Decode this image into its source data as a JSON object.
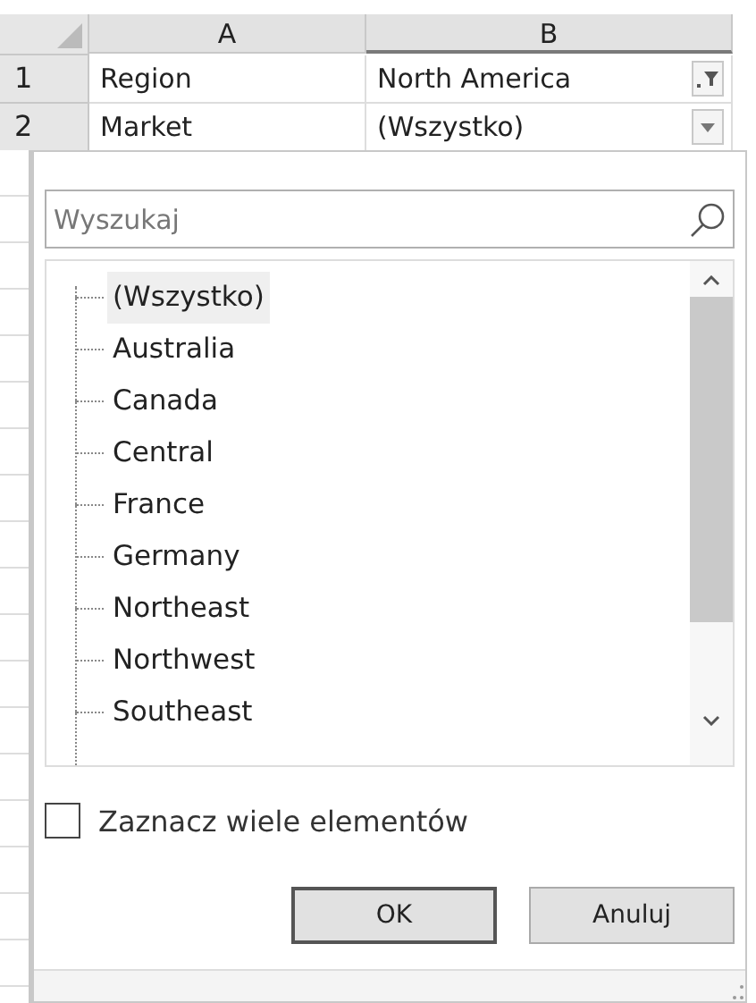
{
  "columns": [
    "A",
    "B"
  ],
  "rows": [
    {
      "number": "1",
      "label": "Region",
      "value": "North America",
      "kind": "filter"
    },
    {
      "number": "2",
      "label": "Market",
      "value": "(Wszystko)",
      "kind": "dropdown"
    }
  ],
  "filter_panel": {
    "search": {
      "placeholder": "Wyszukaj"
    },
    "items": [
      {
        "label": "(Wszystko)",
        "selected": true
      },
      {
        "label": "Australia",
        "selected": false
      },
      {
        "label": "Canada",
        "selected": false
      },
      {
        "label": "Central",
        "selected": false
      },
      {
        "label": "France",
        "selected": false
      },
      {
        "label": "Germany",
        "selected": false
      },
      {
        "label": "Northeast",
        "selected": false
      },
      {
        "label": "Northwest",
        "selected": false
      },
      {
        "label": "Southeast",
        "selected": false
      }
    ],
    "multi_select": {
      "label": "Zaznacz wiele elementów",
      "checked": false
    },
    "buttons": [
      {
        "label": "OK",
        "default": true
      },
      {
        "label": "Anuluj",
        "default": false
      }
    ]
  }
}
